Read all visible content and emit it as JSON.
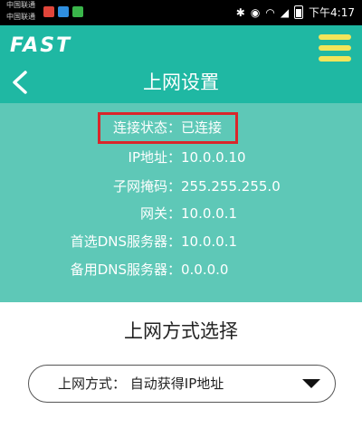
{
  "status_bar": {
    "carrier_1": "中国联通",
    "carrier_2": "中国联通",
    "time": "下午4:17",
    "icons": [
      "bluetooth-icon",
      "eye-icon",
      "wifi-icon",
      "signal-icon",
      "battery-icon"
    ],
    "app_icon_colors": [
      "#e0453a",
      "#2f8fe0",
      "#3ab54a"
    ]
  },
  "header": {
    "logo": "FAST",
    "title": "上网设置",
    "menu_icon": "hamburger-menu-icon",
    "back_icon": "chevron-left-icon"
  },
  "status_info": [
    {
      "label": "连接状态：",
      "value": "已连接"
    },
    {
      "label": "IP地址：",
      "value": "10.0.0.10"
    },
    {
      "label": "子网掩码：",
      "value": "255.255.255.0"
    },
    {
      "label": "网关：",
      "value": "10.0.0.1"
    },
    {
      "label": "首选DNS服务器：",
      "value": "10.0.0.1"
    },
    {
      "label": "备用DNS服务器：",
      "value": "0.0.0.0"
    }
  ],
  "connection_section": {
    "title": "上网方式选择",
    "select_value": "上网方式：  自动获得IP地址"
  },
  "colors": {
    "header_bg": "#1fb8a3",
    "panel_bg": "#5ec8b7",
    "menu_icon": "#f2e55a",
    "highlight": "#d9262b"
  }
}
